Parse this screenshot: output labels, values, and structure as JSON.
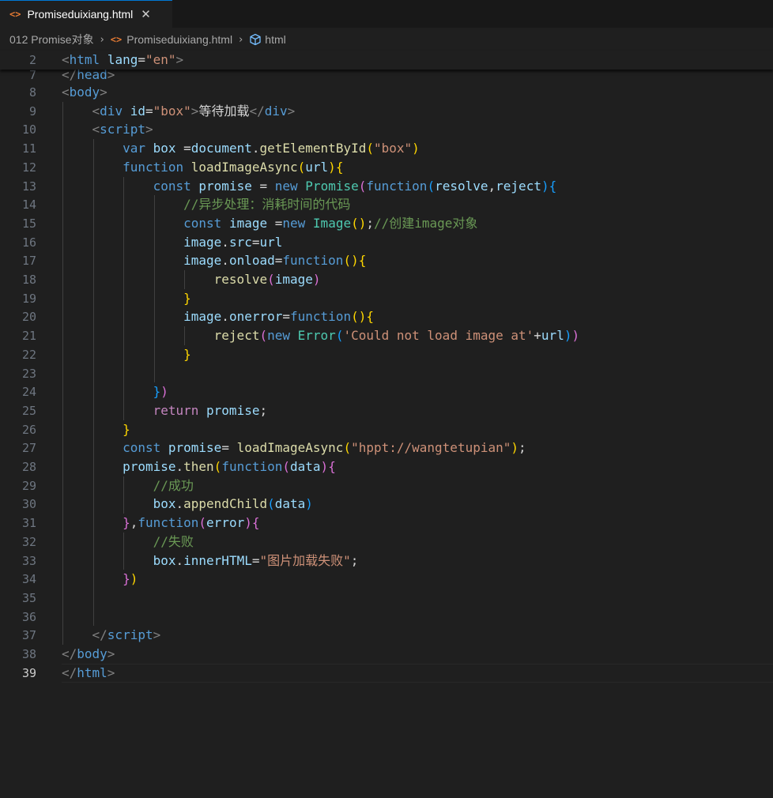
{
  "tab": {
    "icon": "<>",
    "filename": "Promiseduixiang.html",
    "close": "✕"
  },
  "breadcrumb": {
    "folder": "012 Promise对象",
    "file_icon": "<>",
    "file": "Promiseduixiang.html",
    "symbol": "html"
  },
  "editor": {
    "active_line": "39",
    "lines": [
      {
        "n": "2",
        "segs": [
          [
            "t-br",
            "<"
          ],
          [
            "t-tag",
            "html"
          ],
          [
            "t-p",
            " "
          ],
          [
            "t-attr",
            "lang"
          ],
          [
            "t-p",
            "="
          ],
          [
            "t-str",
            "\"en\""
          ],
          [
            "t-br",
            ">"
          ]
        ]
      },
      {
        "n": "7",
        "segs": [
          [
            "t-br",
            "</"
          ],
          [
            "t-tag",
            "head"
          ],
          [
            "t-br",
            ">"
          ]
        ]
      },
      {
        "n": "8",
        "segs": [
          [
            "t-br",
            "<"
          ],
          [
            "t-tag",
            "body"
          ],
          [
            "t-br",
            ">"
          ]
        ]
      },
      {
        "n": "9",
        "segs": [
          [
            "t-p",
            "    "
          ],
          [
            "t-br",
            "<"
          ],
          [
            "t-tag",
            "div"
          ],
          [
            "t-p",
            " "
          ],
          [
            "t-attr",
            "id"
          ],
          [
            "t-p",
            "="
          ],
          [
            "t-str",
            "\"box\""
          ],
          [
            "t-br",
            ">"
          ],
          [
            "t-text",
            "等待加载"
          ],
          [
            "t-br",
            "</"
          ],
          [
            "t-tag",
            "div"
          ],
          [
            "t-br",
            ">"
          ]
        ]
      },
      {
        "n": "10",
        "segs": [
          [
            "t-p",
            "    "
          ],
          [
            "t-br",
            "<"
          ],
          [
            "t-tag",
            "script"
          ],
          [
            "t-br",
            ">"
          ]
        ]
      },
      {
        "n": "11",
        "segs": [
          [
            "t-p",
            "        "
          ],
          [
            "t-kw",
            "var"
          ],
          [
            "t-p",
            " "
          ],
          [
            "t-var",
            "box"
          ],
          [
            "t-p",
            " ="
          ],
          [
            "t-var",
            "document"
          ],
          [
            "t-p",
            "."
          ],
          [
            "t-fn",
            "getElementById"
          ],
          [
            "b1",
            "("
          ],
          [
            "t-str",
            "\"box\""
          ],
          [
            "b1",
            ")"
          ]
        ]
      },
      {
        "n": "12",
        "segs": [
          [
            "t-p",
            "        "
          ],
          [
            "t-kw",
            "function"
          ],
          [
            "t-p",
            " "
          ],
          [
            "t-fn",
            "loadImageAsync"
          ],
          [
            "b1",
            "("
          ],
          [
            "t-var",
            "url"
          ],
          [
            "b1",
            ")"
          ],
          [
            "b1",
            "{"
          ]
        ]
      },
      {
        "n": "13",
        "segs": [
          [
            "t-p",
            "            "
          ],
          [
            "t-kw",
            "const"
          ],
          [
            "t-p",
            " "
          ],
          [
            "t-var",
            "promise"
          ],
          [
            "t-p",
            " = "
          ],
          [
            "t-kw",
            "new"
          ],
          [
            "t-p",
            " "
          ],
          [
            "t-cls",
            "Promise"
          ],
          [
            "b2",
            "("
          ],
          [
            "t-kw",
            "function"
          ],
          [
            "b3",
            "("
          ],
          [
            "t-var",
            "resolve"
          ],
          [
            "t-p",
            ","
          ],
          [
            "t-var",
            "reject"
          ],
          [
            "b3",
            ")"
          ],
          [
            "b3",
            "{"
          ]
        ]
      },
      {
        "n": "14",
        "segs": [
          [
            "t-p",
            "                "
          ],
          [
            "t-cmt",
            "//异步处理：消耗时间的代码"
          ]
        ]
      },
      {
        "n": "15",
        "segs": [
          [
            "t-p",
            "                "
          ],
          [
            "t-kw",
            "const"
          ],
          [
            "t-p",
            " "
          ],
          [
            "t-var",
            "image"
          ],
          [
            "t-p",
            " ="
          ],
          [
            "t-kw",
            "new"
          ],
          [
            "t-p",
            " "
          ],
          [
            "t-cls",
            "Image"
          ],
          [
            "b1",
            "()"
          ],
          [
            "t-p",
            ";"
          ],
          [
            "t-cmt",
            "//创建image对象"
          ]
        ]
      },
      {
        "n": "16",
        "segs": [
          [
            "t-p",
            "                "
          ],
          [
            "t-var",
            "image"
          ],
          [
            "t-p",
            "."
          ],
          [
            "t-var",
            "src"
          ],
          [
            "t-p",
            "="
          ],
          [
            "t-var",
            "url"
          ]
        ]
      },
      {
        "n": "17",
        "segs": [
          [
            "t-p",
            "                "
          ],
          [
            "t-var",
            "image"
          ],
          [
            "t-p",
            "."
          ],
          [
            "t-var",
            "onload"
          ],
          [
            "t-p",
            "="
          ],
          [
            "t-kw",
            "function"
          ],
          [
            "b1",
            "()"
          ],
          [
            "b1",
            "{"
          ]
        ]
      },
      {
        "n": "18",
        "segs": [
          [
            "t-p",
            "                    "
          ],
          [
            "t-fn",
            "resolve"
          ],
          [
            "b2",
            "("
          ],
          [
            "t-var",
            "image"
          ],
          [
            "b2",
            ")"
          ]
        ]
      },
      {
        "n": "19",
        "segs": [
          [
            "t-p",
            "                "
          ],
          [
            "b1",
            "}"
          ]
        ]
      },
      {
        "n": "20",
        "segs": [
          [
            "t-p",
            "                "
          ],
          [
            "t-var",
            "image"
          ],
          [
            "t-p",
            "."
          ],
          [
            "t-var",
            "onerror"
          ],
          [
            "t-p",
            "="
          ],
          [
            "t-kw",
            "function"
          ],
          [
            "b1",
            "()"
          ],
          [
            "b1",
            "{"
          ]
        ]
      },
      {
        "n": "21",
        "segs": [
          [
            "t-p",
            "                    "
          ],
          [
            "t-fn",
            "reject"
          ],
          [
            "b2",
            "("
          ],
          [
            "t-kw",
            "new"
          ],
          [
            "t-p",
            " "
          ],
          [
            "t-cls",
            "Error"
          ],
          [
            "b3",
            "("
          ],
          [
            "t-str",
            "'Could not load image at'"
          ],
          [
            "t-p",
            "+"
          ],
          [
            "t-var",
            "url"
          ],
          [
            "b3",
            ")"
          ],
          [
            "b2",
            ")"
          ]
        ]
      },
      {
        "n": "22",
        "segs": [
          [
            "t-p",
            "                "
          ],
          [
            "b1",
            "}"
          ]
        ]
      },
      {
        "n": "23",
        "segs": []
      },
      {
        "n": "24",
        "segs": [
          [
            "t-p",
            "            "
          ],
          [
            "b3",
            "}"
          ],
          [
            "b2",
            ")"
          ]
        ]
      },
      {
        "n": "25",
        "segs": [
          [
            "t-p",
            "            "
          ],
          [
            "t-ctrl",
            "return"
          ],
          [
            "t-p",
            " "
          ],
          [
            "t-var",
            "promise"
          ],
          [
            "t-p",
            ";"
          ]
        ]
      },
      {
        "n": "26",
        "segs": [
          [
            "t-p",
            "        "
          ],
          [
            "b1",
            "}"
          ]
        ]
      },
      {
        "n": "27",
        "segs": [
          [
            "t-p",
            "        "
          ],
          [
            "t-kw",
            "const"
          ],
          [
            "t-p",
            " "
          ],
          [
            "t-var",
            "promise"
          ],
          [
            "t-p",
            "= "
          ],
          [
            "t-fn",
            "loadImageAsync"
          ],
          [
            "b1",
            "("
          ],
          [
            "t-str",
            "\"hppt://wangtetupian\""
          ],
          [
            "b1",
            ")"
          ],
          [
            "t-p",
            ";"
          ]
        ]
      },
      {
        "n": "28",
        "segs": [
          [
            "t-p",
            "        "
          ],
          [
            "t-var",
            "promise"
          ],
          [
            "t-p",
            "."
          ],
          [
            "t-fn",
            "then"
          ],
          [
            "b1",
            "("
          ],
          [
            "t-kw",
            "function"
          ],
          [
            "b2",
            "("
          ],
          [
            "t-var",
            "data"
          ],
          [
            "b2",
            ")"
          ],
          [
            "b2",
            "{"
          ]
        ]
      },
      {
        "n": "29",
        "segs": [
          [
            "t-p",
            "            "
          ],
          [
            "t-cmt",
            "//成功"
          ]
        ]
      },
      {
        "n": "30",
        "segs": [
          [
            "t-p",
            "            "
          ],
          [
            "t-var",
            "box"
          ],
          [
            "t-p",
            "."
          ],
          [
            "t-fn",
            "appendChild"
          ],
          [
            "b3",
            "("
          ],
          [
            "t-var",
            "data"
          ],
          [
            "b3",
            ")"
          ]
        ]
      },
      {
        "n": "31",
        "segs": [
          [
            "t-p",
            "        "
          ],
          [
            "b2",
            "}"
          ],
          [
            "t-p",
            ","
          ],
          [
            "t-kw",
            "function"
          ],
          [
            "b2",
            "("
          ],
          [
            "t-var",
            "error"
          ],
          [
            "b2",
            ")"
          ],
          [
            "b2",
            "{"
          ]
        ]
      },
      {
        "n": "32",
        "segs": [
          [
            "t-p",
            "            "
          ],
          [
            "t-cmt",
            "//失败"
          ]
        ]
      },
      {
        "n": "33",
        "segs": [
          [
            "t-p",
            "            "
          ],
          [
            "t-var",
            "box"
          ],
          [
            "t-p",
            "."
          ],
          [
            "t-var",
            "innerHTML"
          ],
          [
            "t-p",
            "="
          ],
          [
            "t-str",
            "\"图片加载失败\""
          ],
          [
            "t-p",
            ";"
          ]
        ]
      },
      {
        "n": "34",
        "segs": [
          [
            "t-p",
            "        "
          ],
          [
            "b2",
            "}"
          ],
          [
            "b1",
            ")"
          ]
        ]
      },
      {
        "n": "35",
        "segs": []
      },
      {
        "n": "36",
        "segs": []
      },
      {
        "n": "37",
        "segs": [
          [
            "t-p",
            "    "
          ],
          [
            "t-br",
            "</"
          ],
          [
            "t-tag",
            "script"
          ],
          [
            "t-br",
            ">"
          ]
        ]
      },
      {
        "n": "38",
        "segs": [
          [
            "t-br",
            "</"
          ],
          [
            "t-tag",
            "body"
          ],
          [
            "t-br",
            ">"
          ]
        ]
      },
      {
        "n": "39",
        "segs": [
          [
            "t-br",
            "</"
          ],
          [
            "t-tag",
            "html"
          ],
          [
            "t-br",
            ">"
          ]
        ]
      }
    ]
  }
}
